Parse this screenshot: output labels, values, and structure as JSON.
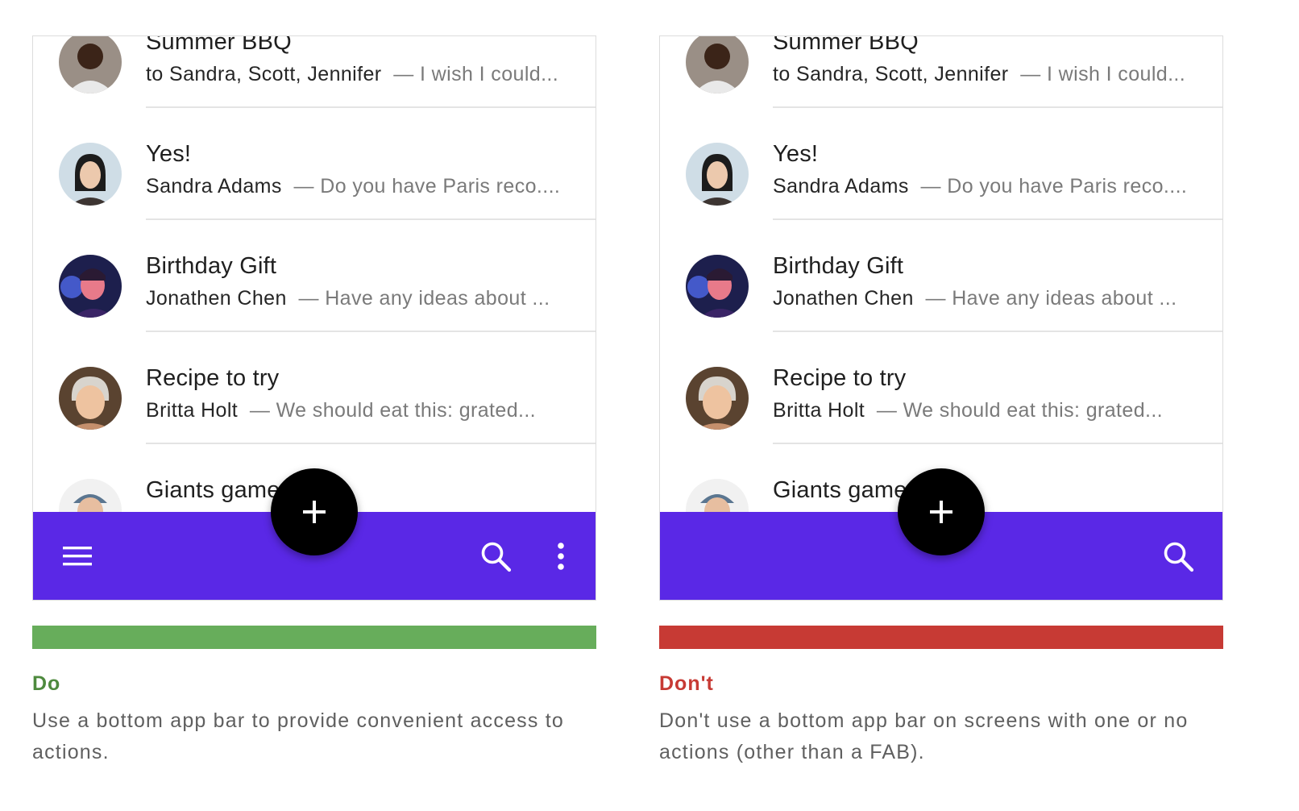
{
  "panels": {
    "do": {
      "verdict": "Do",
      "caption": "Use a bottom app bar to provide convenient access to actions.",
      "status_color": "#67ad5b",
      "bar_icons": [
        "menu-icon",
        "search-icon",
        "more-vert-icon"
      ]
    },
    "dont": {
      "verdict": "Don't",
      "caption": "Don't use a bottom app bar on screens with one or no actions (other than a FAB).",
      "status_color": "#c73a34",
      "bar_icons": [
        "search-icon"
      ]
    }
  },
  "messages": [
    {
      "subject": "Summer BBQ",
      "sender": "to Sandra, Scott, Jennifer",
      "snippet": "— I wish I could..."
    },
    {
      "subject": "Yes!",
      "sender": "Sandra Adams",
      "snippet": "— Do you have Paris reco...."
    },
    {
      "subject": "Birthday Gift",
      "sender": "Jonathen Chen",
      "snippet": "— Have any ideas about ..."
    },
    {
      "subject": "Recipe to try",
      "sender": "Britta Holt",
      "snippet": "— We should eat this: grated..."
    },
    {
      "subject": "Giants game",
      "sender": "",
      "snippet": ""
    }
  ],
  "colors": {
    "app_bar": "#5a28e6",
    "fab": "#000000",
    "do_green": "#67ad5b",
    "dont_red": "#c73a34"
  },
  "fab_icon": "add-icon"
}
